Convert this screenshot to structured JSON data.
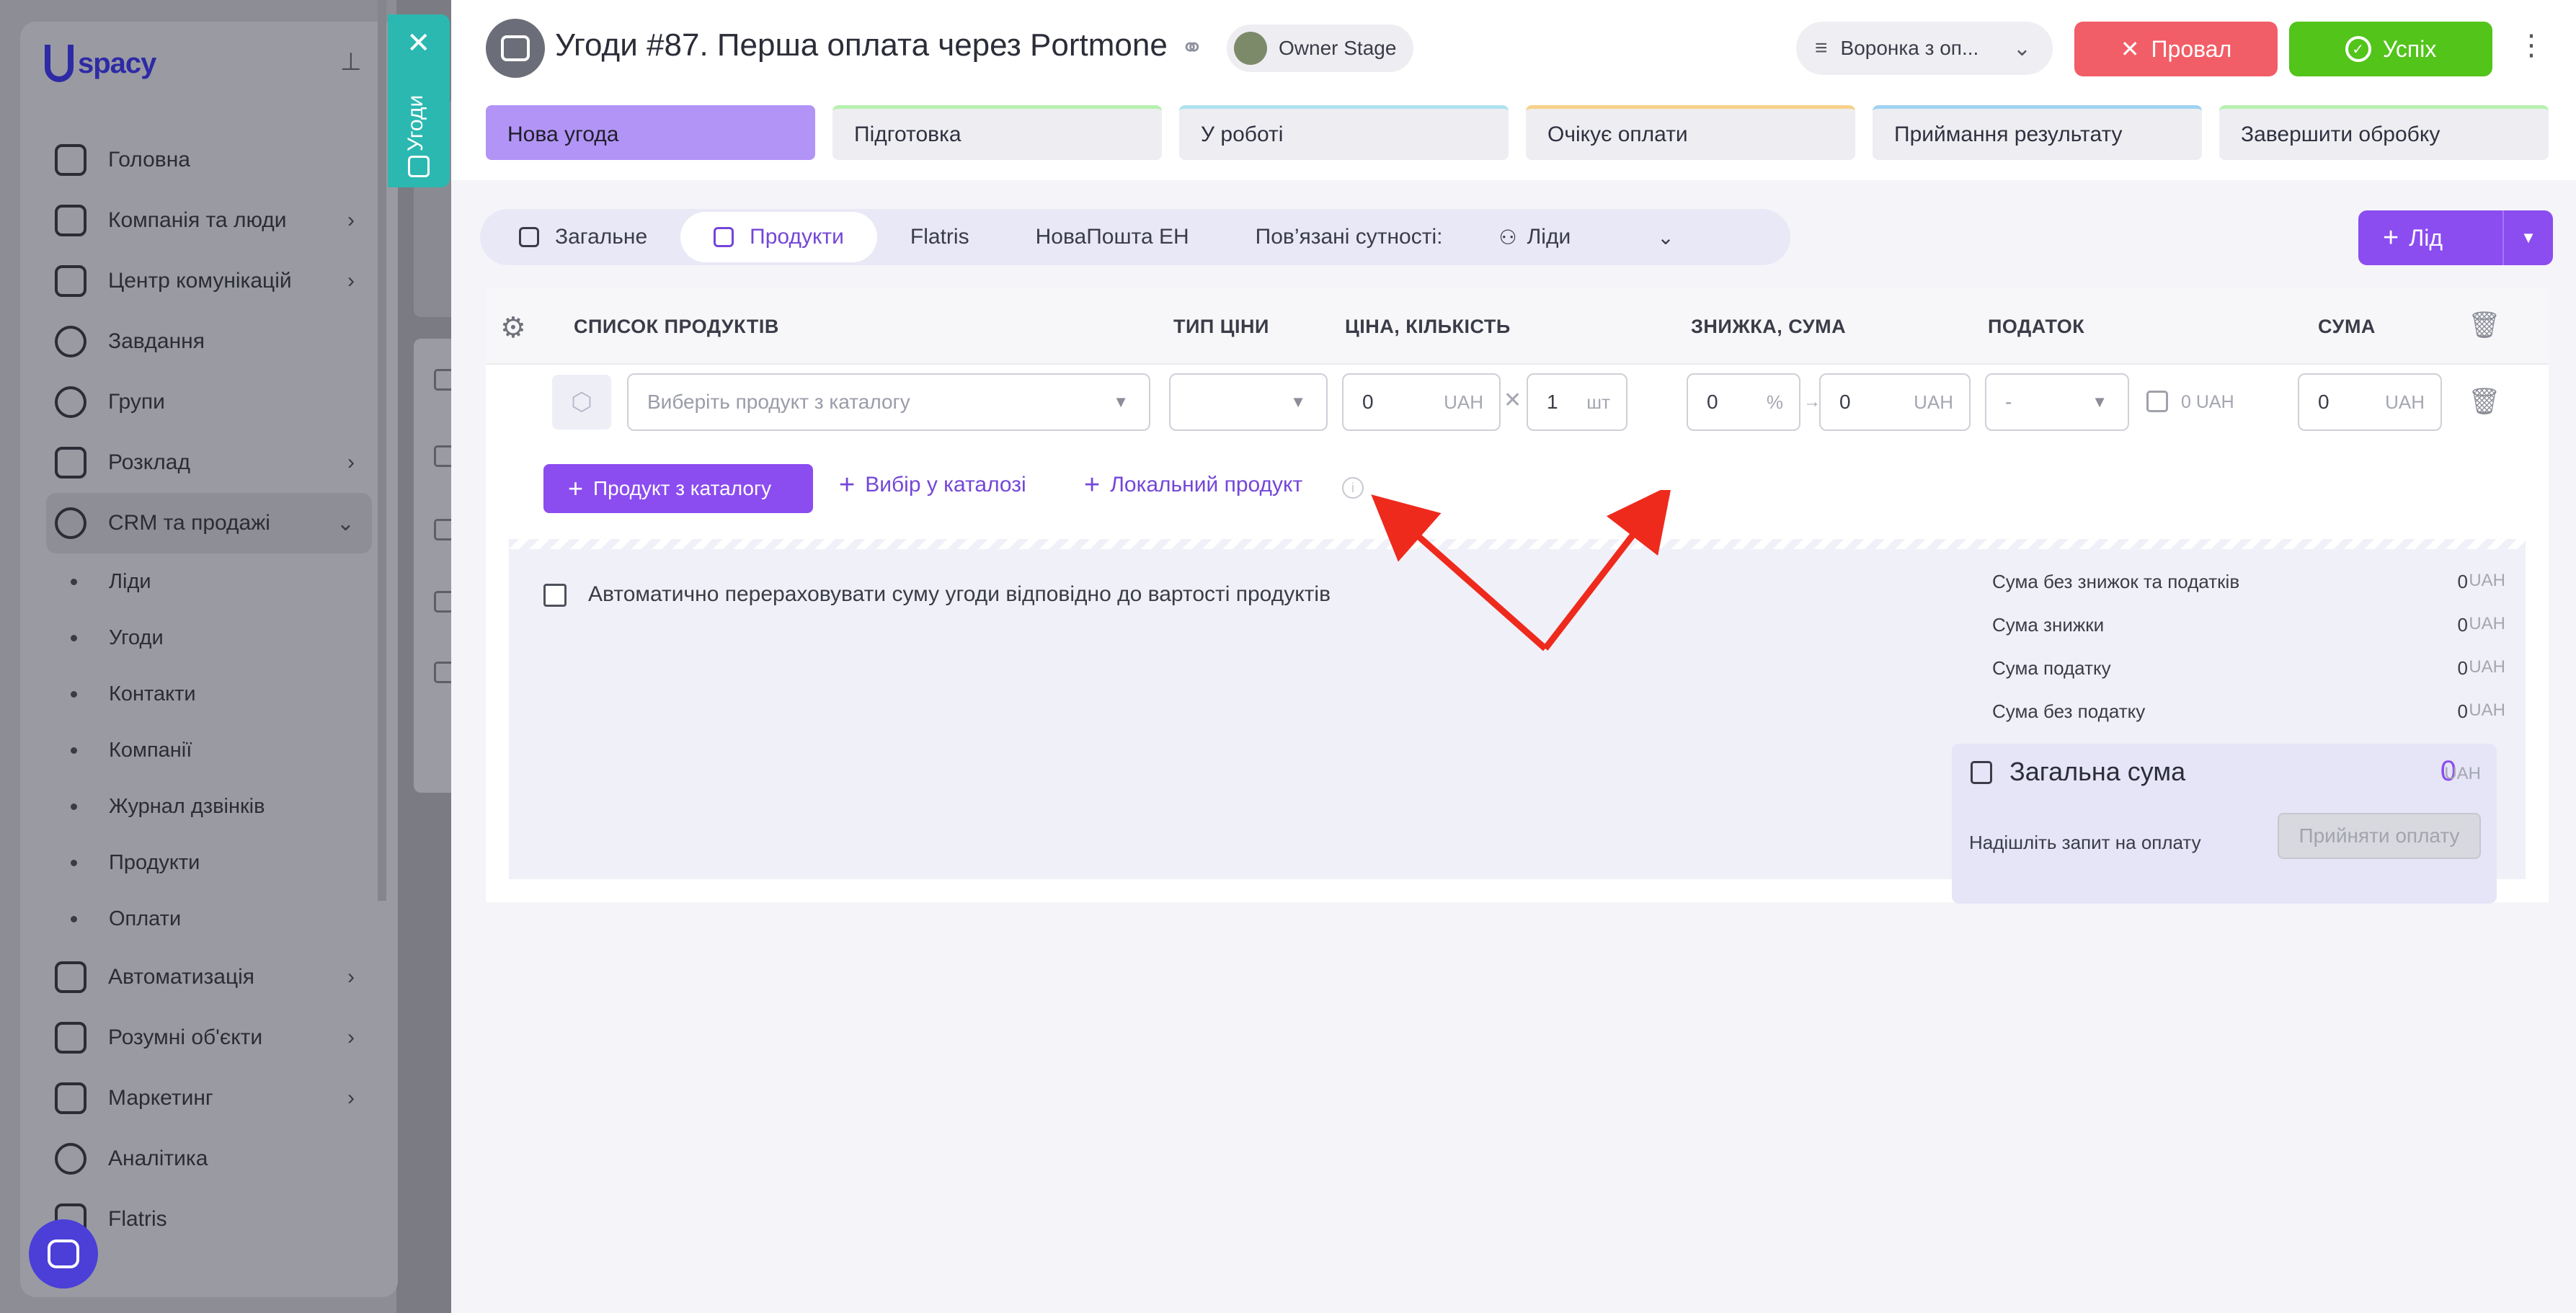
{
  "sidebar": {
    "logo": "spacy",
    "items": [
      {
        "label": "Головна"
      },
      {
        "label": "Компанія та люди"
      },
      {
        "label": "Центр комунікацій"
      },
      {
        "label": "Завдання"
      },
      {
        "label": "Групи"
      },
      {
        "label": "Розклад"
      },
      {
        "label": "CRM та продажі"
      }
    ],
    "crm_sub": [
      "Ліди",
      "Угоди",
      "Контакти",
      "Компанії",
      "Журнал дзвінків",
      "Продукти",
      "Оплати"
    ],
    "items_bottom": [
      {
        "label": "Автоматизація"
      },
      {
        "label": "Розумні об'єкти"
      },
      {
        "label": "Маркетинг"
      },
      {
        "label": "Аналітика"
      },
      {
        "label": "Flatris"
      }
    ]
  },
  "vertical_tab": {
    "label": "Угоди",
    "close": "✕"
  },
  "header": {
    "title": "Угоди #87. Перша оплата через Portmone",
    "owner": "Owner Stage",
    "funnel": "Воронка з оп...",
    "fail_label": "Провал",
    "success_label": "Успіх"
  },
  "stages": [
    "Нова угода",
    "Підготовка",
    "У роботі",
    "Очікує оплати",
    "Приймання результату",
    "Завершити обробку"
  ],
  "tabs": {
    "general": "Загальне",
    "products": "Продукти",
    "flatris": "Flatris",
    "nova": "НоваПошта ЕН",
    "related": "Пов’язані сутності:",
    "leads": "Ліди"
  },
  "lead_button": "Лід",
  "table": {
    "col_products": "СПИСОК ПРОДУКТІВ",
    "col_price_type": "ТИП ЦІНИ",
    "col_price_qty": "ЦІНА, КІЛЬКІСТЬ",
    "col_discount": "ЗНИЖКА, СУМА",
    "col_tax": "ПОДАТОК",
    "col_sum": "СУМА",
    "row": {
      "product_placeholder": "Виберіть продукт з каталогу",
      "price": "0",
      "price_unit": "UAH",
      "qty": "1",
      "qty_unit": "шт",
      "discount": "0",
      "discount_unit": "%",
      "discount_sum": "0",
      "discount_sum_unit": "UAH",
      "tax": "-",
      "tax_value": "0 UAH",
      "sum": "0",
      "sum_unit": "UAH"
    }
  },
  "actions": {
    "from_catalog": "Продукт з каталогу",
    "choose_catalog": "Вибір у каталозі",
    "local_product": "Локальний продукт"
  },
  "summary": {
    "auto_recalc": "Автоматично перераховувати суму угоди відповідно до вартості продуктів",
    "rows": [
      {
        "label": "Сума без знижок та податків",
        "value": "0",
        "unit": "UAH"
      },
      {
        "label": "Сума знижки",
        "value": "0",
        "unit": "UAH"
      },
      {
        "label": "Сума податку",
        "value": "0",
        "unit": "UAH"
      },
      {
        "label": "Сума без податку",
        "value": "0",
        "unit": "UAH"
      }
    ],
    "total_label": "Загальна сума",
    "total_value": "0",
    "total_unit": "UAH",
    "payment_request": "Надішліть запит на оплату",
    "accept_payment": "Прийняти оплату"
  },
  "colors": {
    "accent": "#8b4cf0",
    "fail": "#f25e67",
    "success": "#52c41a",
    "teal_tab": "#2bb8b1",
    "annotation": "#ee2a1d"
  }
}
